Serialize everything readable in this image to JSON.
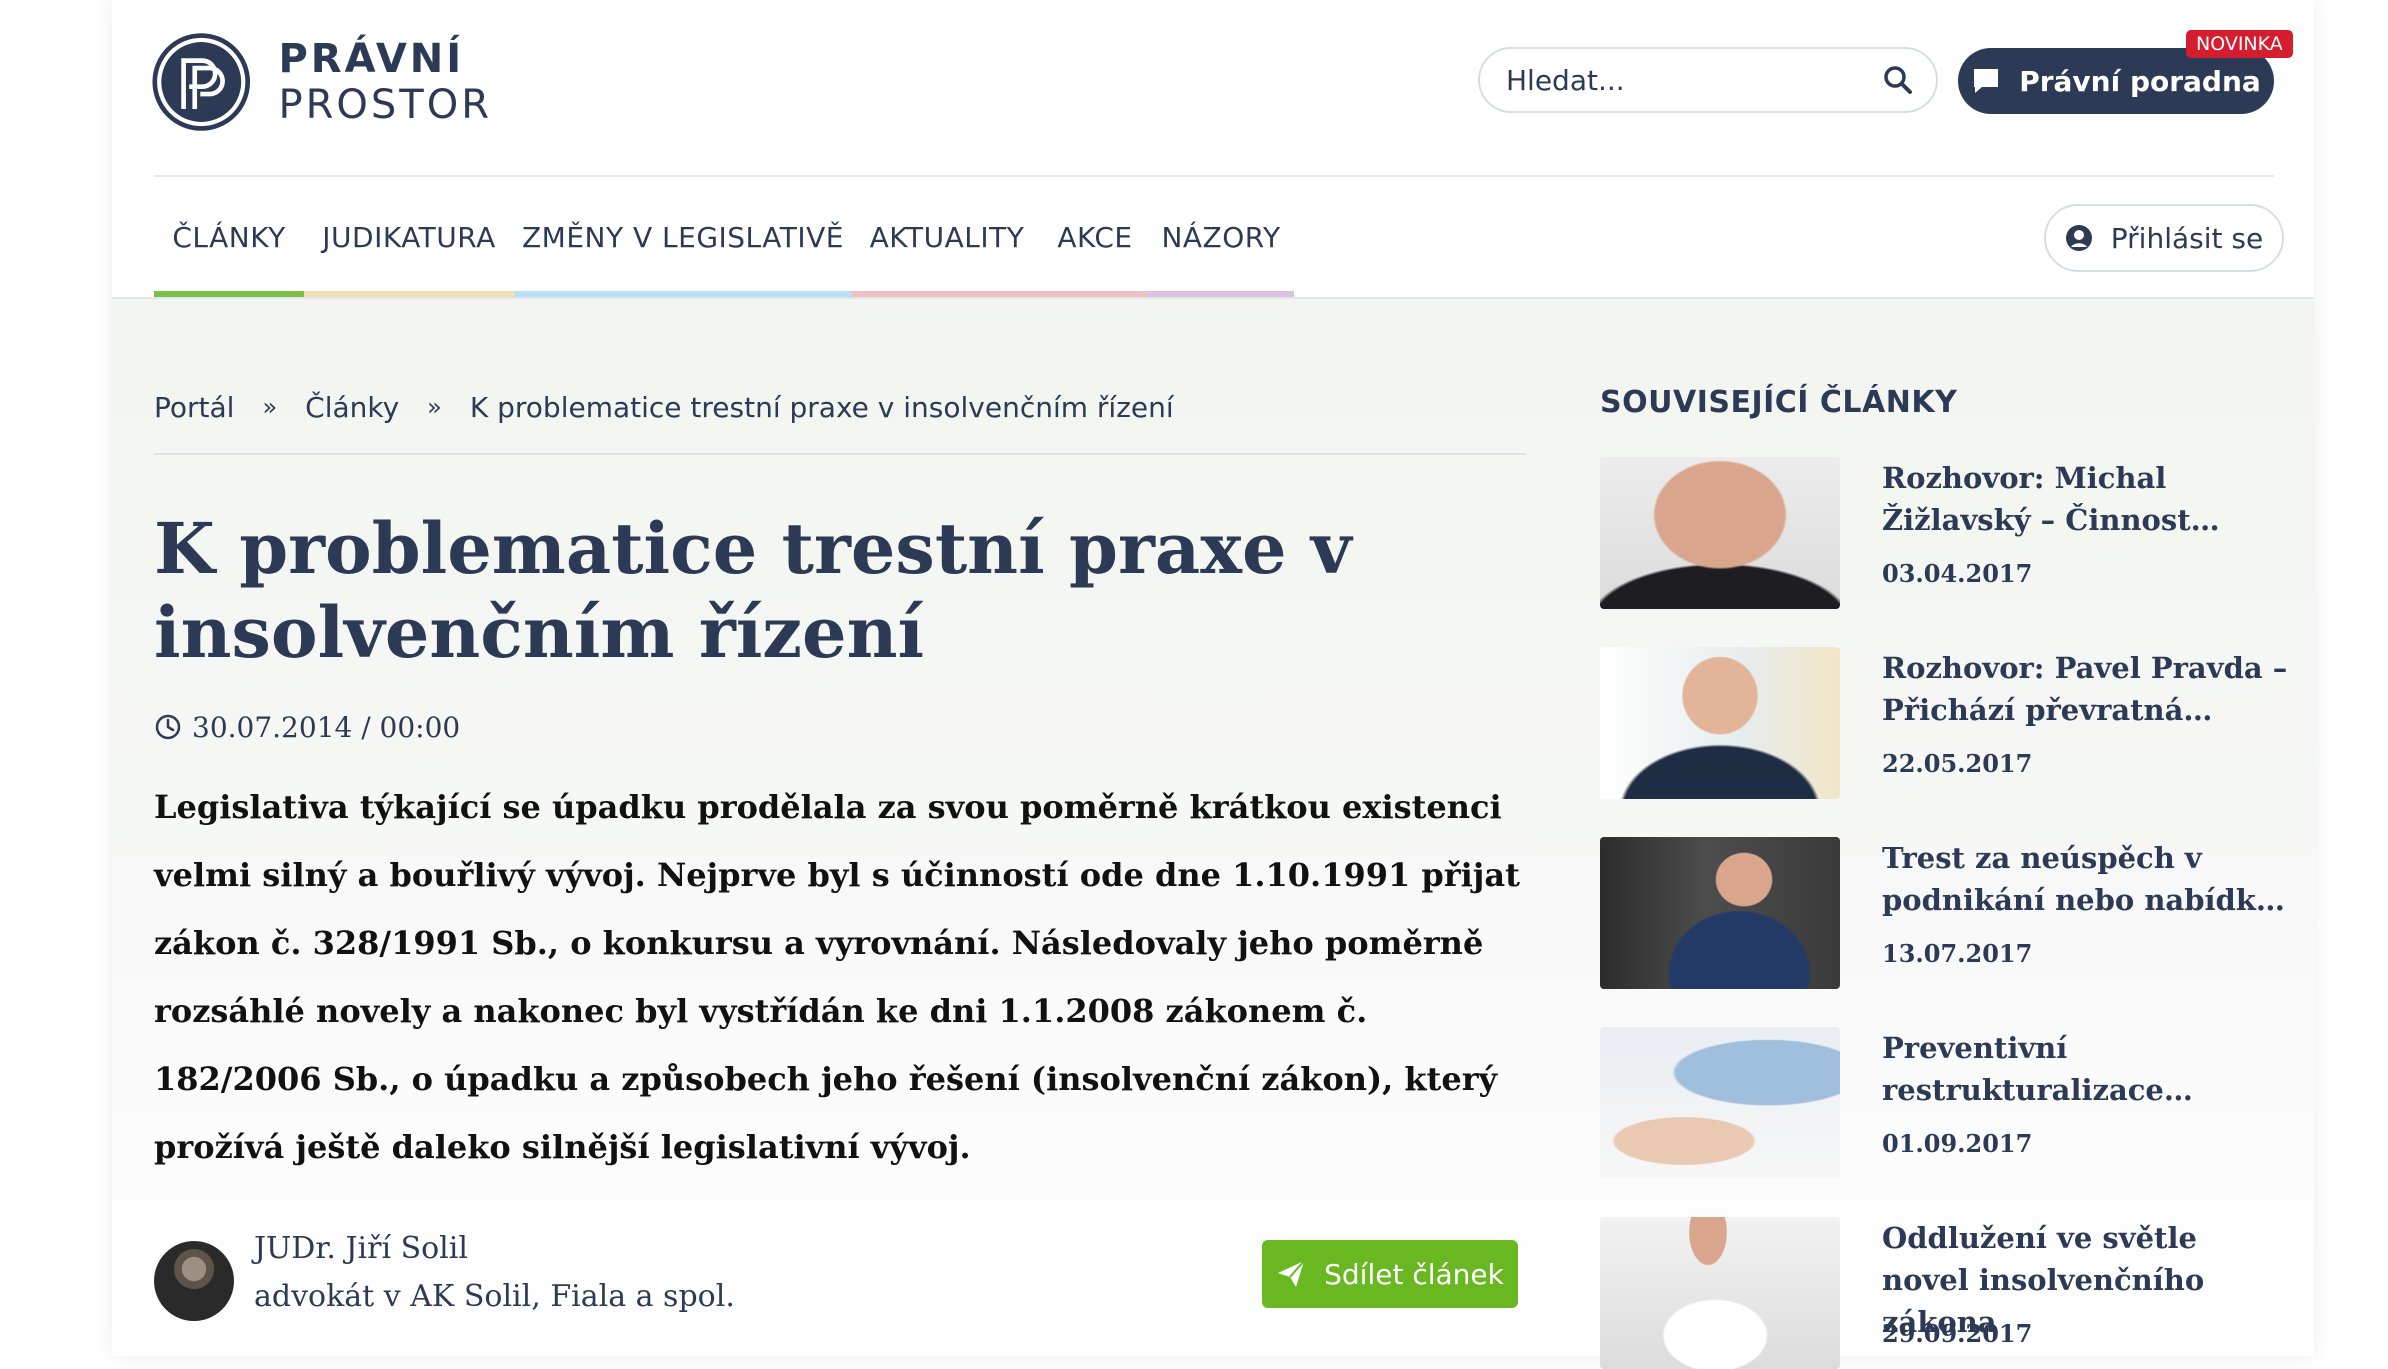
{
  "header": {
    "logo_bold": "PRÁVNÍ",
    "logo_light": "PROSTOR",
    "search_placeholder": "Hledat...",
    "advice_button": "Právní poradna",
    "advice_badge": "NOVINKA",
    "login_button": "Přihlásit se"
  },
  "nav": {
    "items": [
      {
        "label": "ČLÁNKY",
        "color": "#7ac142"
      },
      {
        "label": "JUDIKATURA",
        "color": "#f3dfb1"
      },
      {
        "label": "ZMĚNY V LEGISLATIVĚ",
        "color": "#b7dff5"
      },
      {
        "label": "AKTUALITY",
        "color": "#f2bfc5"
      },
      {
        "label": "AKCE",
        "color": "#f2bfc5"
      },
      {
        "label": "NÁZORY",
        "color": "#dcc0e4"
      }
    ]
  },
  "breadcrumb": {
    "items": [
      "Portál",
      "Články",
      "K problematice trestní praxe v insolvenčním řízení"
    ],
    "separator": "»"
  },
  "article": {
    "title": "K problematice trestní praxe v insolvenčním řízení",
    "date": "30.07.2014 / 00:00",
    "lead": "Legislativa týkající se úpadku prodělala za svou poměrně krátkou existenci velmi silný a bouřlivý vývoj. Nejprve byl s účinností ode dne 1.10.1991 přijat zákon č. 328/1991 Sb., o konkursu a vyrovnání. Následovaly jeho poměrně rozsáhlé novely a nakonec byl vystřídán ke dni 1.1.2008 zákonem č. 182/2006 Sb., o úpadku a způsobech jeho řešení (insolvenční zákon), který prožívá ještě daleko silnější legislativní vývoj.",
    "author_name": "JUDr. Jiří Solil",
    "author_role": "advokát v AK Solil, Fiala a spol.",
    "share_button": "Sdílet článek"
  },
  "sidebar": {
    "title": "SOUVISEJÍCÍ ČLÁNKY",
    "items": [
      {
        "title": "Rozhovor: Michal Žižlavský – Činnost…",
        "date": "03.04.2017"
      },
      {
        "title": "Rozhovor: Pavel Pravda – Přichází převratná…",
        "date": "22.05.2017"
      },
      {
        "title": "Trest za neúspěch v podnikání nebo nabídk…",
        "date": "13.07.2017"
      },
      {
        "title": "Preventivní restrukturalizace…",
        "date": "01.09.2017"
      },
      {
        "title": "Oddlužení ve světle novel insolvenčního zákona",
        "date": "29.09.2017"
      }
    ]
  },
  "colors": {
    "brand": "#2c3a55",
    "share_green": "#6ab821",
    "badge_red": "#d41d2f"
  }
}
